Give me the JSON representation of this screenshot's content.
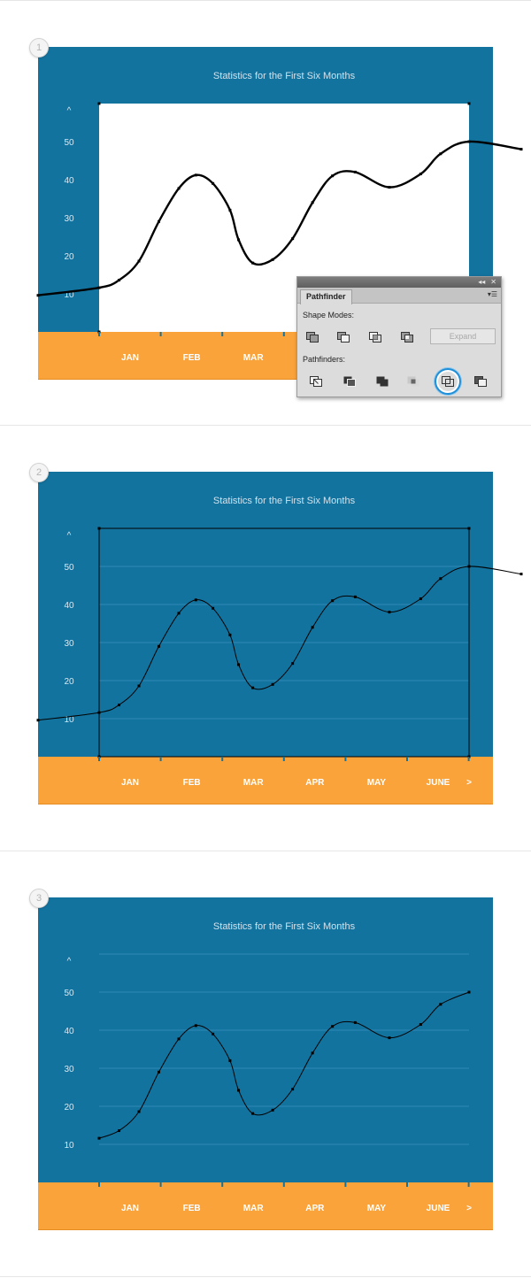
{
  "colors": {
    "chart_background": "#13739f",
    "axis_band": "#fba33b",
    "plot_area_step1": "#ffffff",
    "gridline": "#2f8ab5",
    "curve": "#000000",
    "pathfinder_selected": "#1e8fd8"
  },
  "steps": [
    {
      "number": "1"
    },
    {
      "number": "2"
    },
    {
      "number": "3"
    }
  ],
  "chart_data": {
    "type": "line",
    "title": "Statistics for the First Six Months",
    "y_ticks": [
      "10",
      "20",
      "30",
      "40",
      "50"
    ],
    "y_axis_arrow": "^",
    "x_axis_arrow": ">",
    "categories": [
      "JAN",
      "FEB",
      "MAR",
      "APR",
      "MAY",
      "JUNE"
    ],
    "ylim": [
      0,
      60
    ],
    "grid": true,
    "series": [
      {
        "points": [
          [
            0.15,
            11.6
          ],
          [
            0.5,
            13.6
          ],
          [
            0.85,
            18.6
          ],
          [
            1.2,
            29.0
          ],
          [
            1.55,
            37.7
          ],
          [
            1.85,
            41.2
          ],
          [
            2.15,
            39.0
          ],
          [
            2.45,
            32.0
          ],
          [
            2.6,
            24.2
          ],
          [
            2.85,
            18.1
          ],
          [
            3.2,
            19.0
          ],
          [
            3.55,
            24.5
          ],
          [
            3.9,
            34.0
          ],
          [
            4.25,
            41.0
          ],
          [
            4.65,
            42.0
          ],
          [
            5.25,
            38.0
          ],
          [
            5.8,
            41.5
          ],
          [
            6.15,
            46.8
          ],
          [
            6.65,
            50.0
          ],
          [
            7.5,
            48.0
          ]
        ]
      }
    ]
  },
  "pathfinder": {
    "tab_label": "Pathfinder",
    "shape_modes_label": "Shape Modes:",
    "pathfinders_label": "Pathfinders:",
    "expand_label": "Expand",
    "collapse_glyph": "◂◂",
    "close_glyph": "✕",
    "menu_glyph": "▾☰",
    "shape_modes": [
      "unite",
      "minus-front",
      "intersect",
      "exclude"
    ],
    "pathfinder_ops": [
      "divide",
      "trim",
      "merge",
      "crop",
      "outline",
      "minus-back"
    ],
    "selected_op": "outline"
  }
}
